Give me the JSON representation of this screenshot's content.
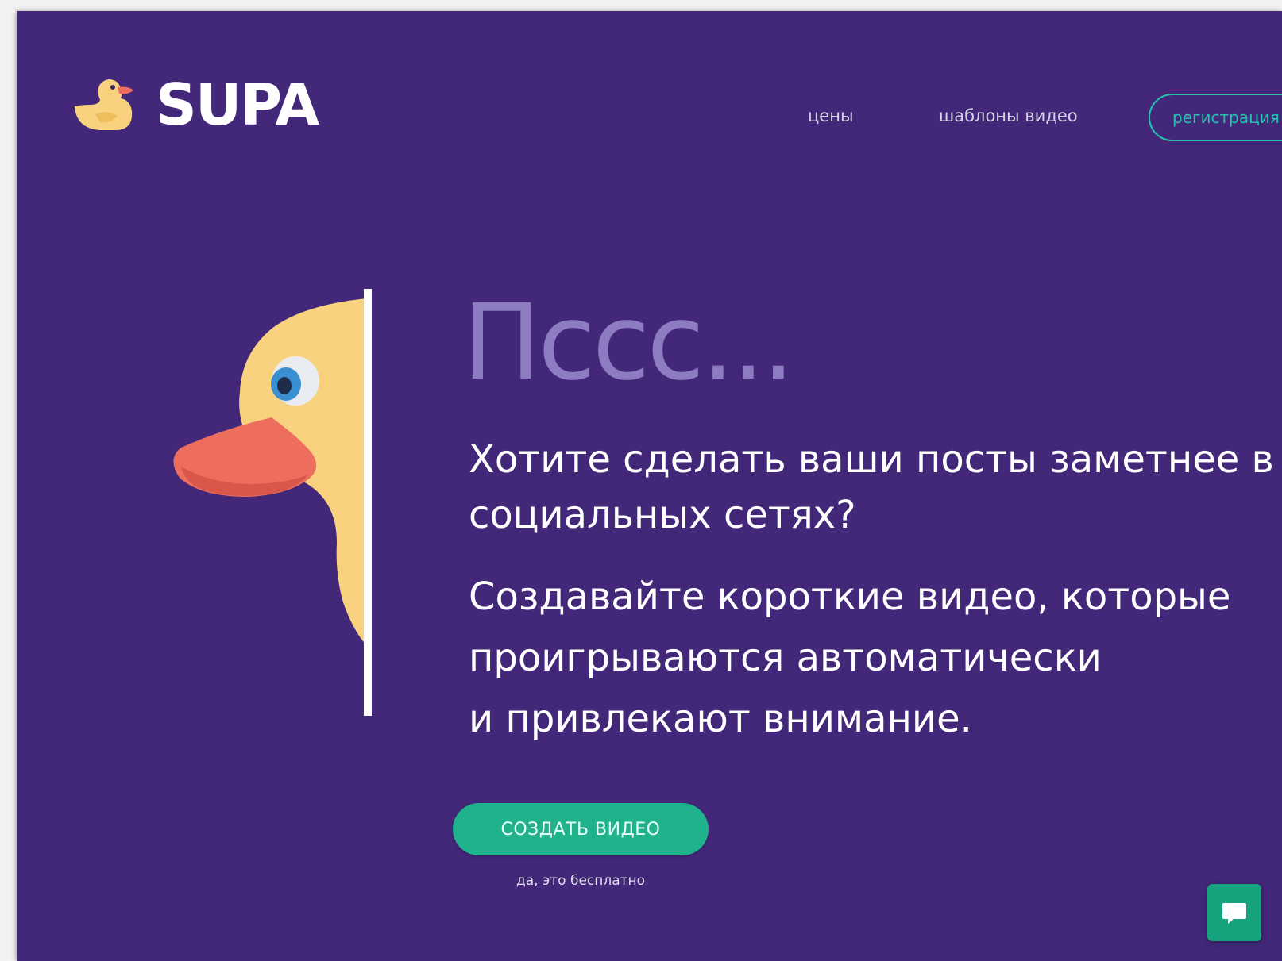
{
  "header": {
    "logo_text": "SUPA",
    "nav": {
      "prices": "цены",
      "templates": "шаблоны видео",
      "register": "регистрация"
    }
  },
  "hero": {
    "title": "Пссс...",
    "subtitle": "Хотите сделать ваши посты заметнее в социальных сетях?",
    "body_lines": [
      "Создавайте короткие видео, которые",
      "проигрываются автоматически",
      "и привлекают внимание."
    ],
    "cta_label": "СОЗДАТЬ ВИДЕО",
    "cta_note": "да, это бесплатно"
  },
  "icons": {
    "logo": "duck-logo-icon",
    "hero": "duck-illustration",
    "chat": "chat-bubble-icon"
  },
  "colors": {
    "background": "#43287a",
    "accent": "#1fb28d",
    "outline_accent": "#27c2ad",
    "title": "#8e7cc3",
    "duck_body": "#f8d27f",
    "duck_beak": "#ee6e5e"
  }
}
